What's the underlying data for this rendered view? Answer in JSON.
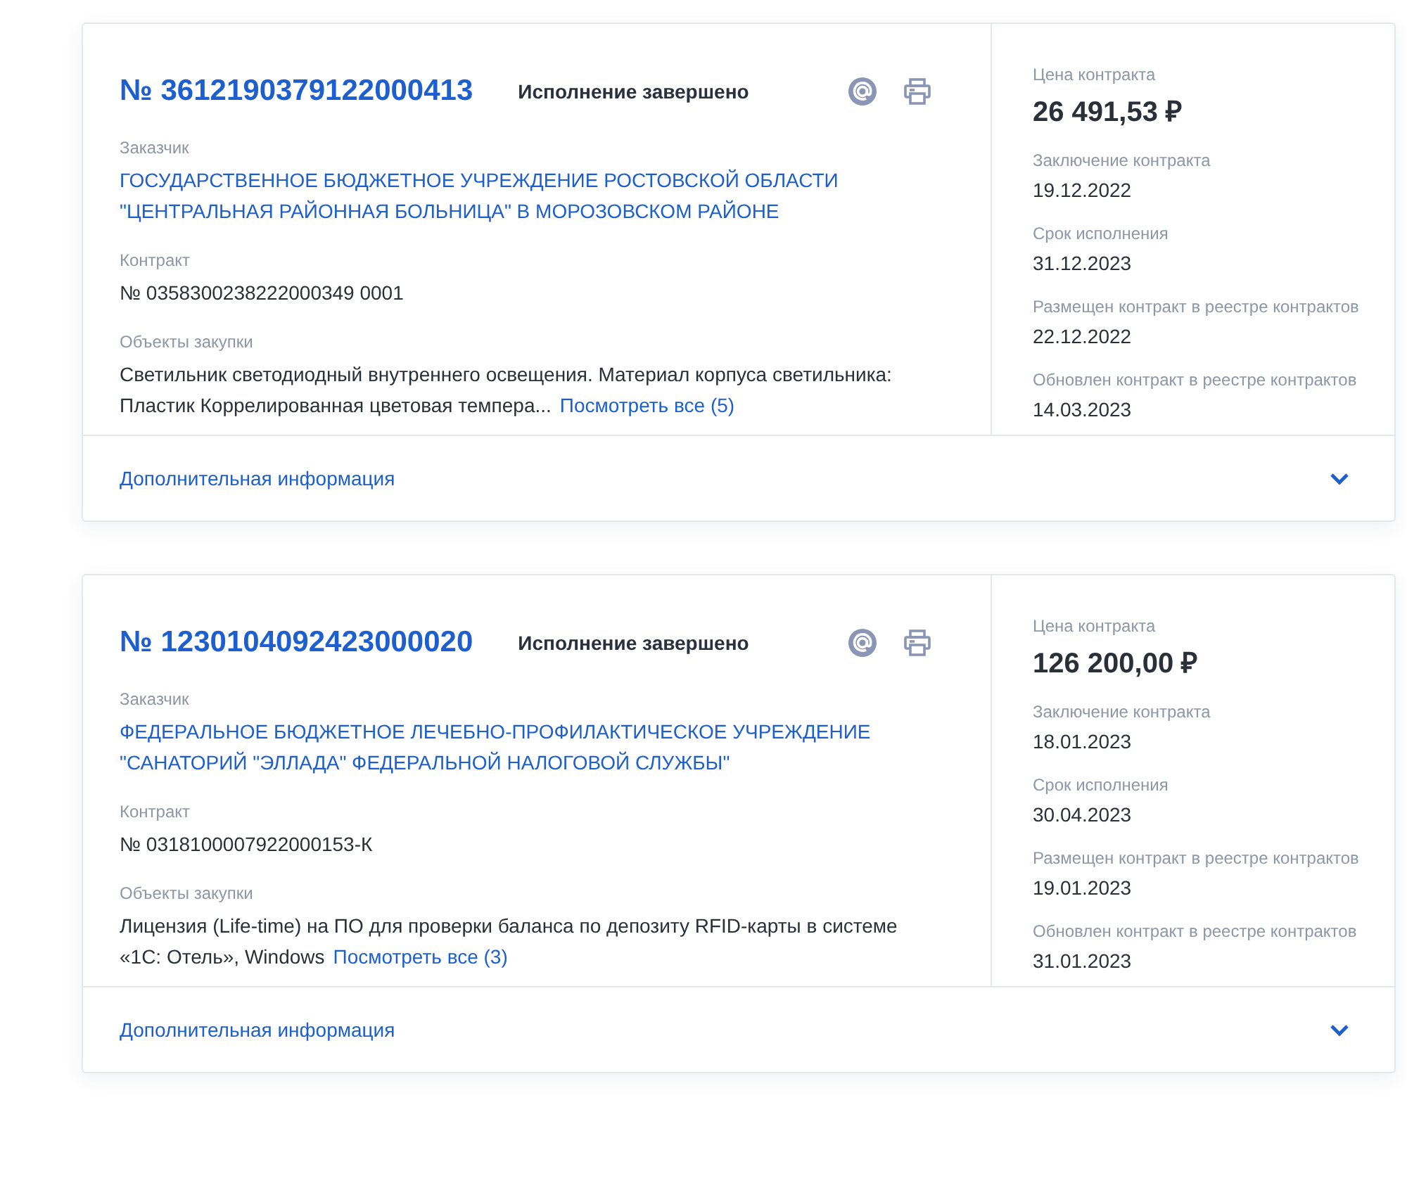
{
  "cards": [
    {
      "number": "№ 3612190379122000413",
      "status": "Исполнение завершено",
      "customer": {
        "label": "Заказчик",
        "value": "ГОСУДАРСТВЕННОЕ БЮДЖЕТНОЕ УЧРЕЖДЕНИЕ РОСТОВСКОЙ ОБЛАСТИ \"ЦЕНТРАЛЬНАЯ РАЙОННАЯ БОЛЬНИЦА\" В МОРОЗОВСКОМ РАЙОНЕ"
      },
      "contract": {
        "label": "Контракт",
        "value": "№ 0358300238222000349 0001"
      },
      "objects": {
        "label": "Объекты закупки",
        "text": "Светильник светодиодный внутреннего освещения. Материал корпуса светильника: Пластик Коррелированная цветовая темпера...",
        "link": "Посмотреть все (5)"
      },
      "price": {
        "label": "Цена контракта",
        "value": "26 491,53 ₽"
      },
      "facts": [
        {
          "label": "Заключение контракта",
          "value": "19.12.2022"
        },
        {
          "label": "Срок исполнения",
          "value": "31.12.2023"
        },
        {
          "label": "Размещен контракт в реестре контрактов",
          "value": "22.12.2022"
        },
        {
          "label": "Обновлен контракт в реестре контрактов",
          "value": "14.03.2023"
        }
      ],
      "more": {
        "label": "Дополнительная информация",
        "expanded": false
      }
    },
    {
      "number": "№ 1230104092423000020",
      "status": "Исполнение завершено",
      "customer": {
        "label": "Заказчик",
        "value": "ФЕДЕРАЛЬНОЕ БЮДЖЕТНОЕ ЛЕЧЕБНО-ПРОФИЛАКТИЧЕСКОЕ УЧРЕЖДЕНИЕ \"САНАТОРИЙ \"ЭЛЛАДА\" ФЕДЕРАЛЬНОЙ НАЛОГОВОЙ СЛУЖБЫ\""
      },
      "contract": {
        "label": "Контракт",
        "value": "№ 0318100007922000153-К"
      },
      "objects": {
        "label": "Объекты закупки",
        "text": "Лицензия (Life-time) на ПО для проверки баланса по депозиту RFID-карты в системе «1С: Отель», Windows",
        "link": "Посмотреть все (3)"
      },
      "price": {
        "label": "Цена контракта",
        "value": "126 200,00 ₽"
      },
      "facts": [
        {
          "label": "Заключение контракта",
          "value": "18.01.2023"
        },
        {
          "label": "Срок исполнения",
          "value": "30.04.2023"
        },
        {
          "label": "Размещен контракт в реестре контрактов",
          "value": "19.01.2023"
        },
        {
          "label": "Обновлен контракт в реестре контрактов",
          "value": "31.01.2023"
        }
      ],
      "more": {
        "label": "Дополнительная информация",
        "expanded": false
      }
    }
  ]
}
